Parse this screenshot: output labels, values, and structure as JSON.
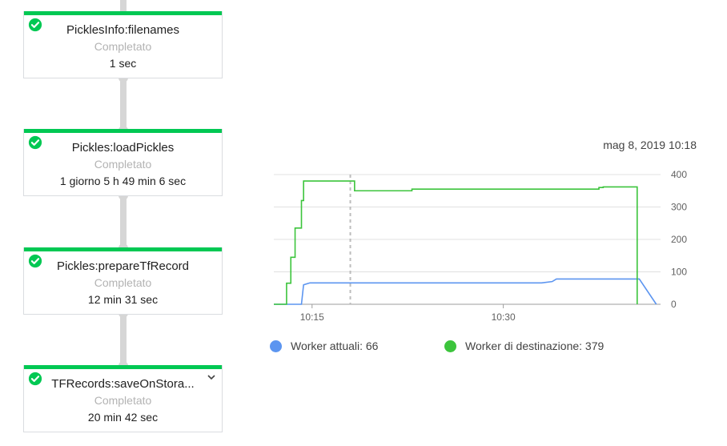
{
  "steps": [
    {
      "name": "PicklesInfo:filenames",
      "status": "Completato",
      "duration": "1 sec"
    },
    {
      "name": "Pickles:loadPickles",
      "status": "Completato",
      "duration": "1 giorno 5 h 49 min 6 sec"
    },
    {
      "name": "Pickles:prepareTfRecord",
      "status": "Completato",
      "duration": "12 min 31 sec"
    },
    {
      "name": "TFRecords:saveOnStora...",
      "status": "Completato",
      "duration": "20 min 42 sec"
    }
  ],
  "icons": {
    "step_status": "check-circle-icon",
    "expand": "chevron-down-icon"
  },
  "colors": {
    "success": "#00c853",
    "current_workers": "#5c95f0",
    "target_workers": "#3cc43c"
  },
  "chart": {
    "timestamp": "mag 8, 2019 10:18"
  },
  "chart_data": {
    "type": "line",
    "x_unit": "time",
    "x_ticks": [
      "10:15",
      "10:30"
    ],
    "y_ticks": [
      0,
      100,
      200,
      300,
      400
    ],
    "ylim": [
      0,
      400
    ],
    "grid": true,
    "marker_time": "10:18",
    "series": [
      {
        "name": "Worker attuali",
        "legend": "Worker attuali: 66",
        "color": "#5c95f0",
        "points": [
          [
            "10:12:00",
            0
          ],
          [
            "10:14:10",
            0
          ],
          [
            "10:14:20",
            60
          ],
          [
            "10:14:50",
            66
          ],
          [
            "10:33:00",
            66
          ],
          [
            "10:33:50",
            70
          ],
          [
            "10:34:10",
            78
          ],
          [
            "10:40:40",
            78
          ],
          [
            "10:42:00",
            0
          ]
        ]
      },
      {
        "name": "Worker di destinazione",
        "legend": "Worker di destinazione: 379",
        "color": "#3cc43c",
        "step": true,
        "points": [
          [
            "10:12:00",
            0
          ],
          [
            "10:13:00",
            65
          ],
          [
            "10:13:20",
            145
          ],
          [
            "10:13:40",
            235
          ],
          [
            "10:14:10",
            320
          ],
          [
            "10:14:20",
            380
          ],
          [
            "10:18:20",
            350
          ],
          [
            "10:22:50",
            355
          ],
          [
            "10:25:00",
            355
          ],
          [
            "10:37:30",
            360
          ],
          [
            "10:37:50",
            362
          ],
          [
            "10:40:30",
            0
          ]
        ]
      }
    ]
  }
}
